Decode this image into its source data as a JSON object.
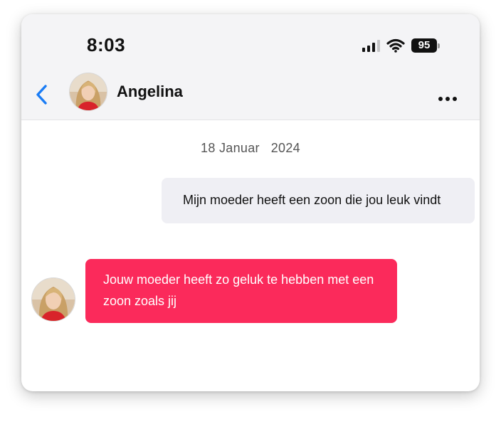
{
  "status_bar": {
    "time": "8:03",
    "battery": "95",
    "icons": [
      "signal-icon",
      "wifi-icon",
      "battery-icon"
    ]
  },
  "header": {
    "contact_name": "Angelina",
    "back_icon": "chevron-left-icon",
    "more_icon": "ellipsis-icon"
  },
  "chat": {
    "date": "18 Januar   2024",
    "messages": [
      {
        "direction": "outgoing",
        "text": "Mijn moeder heeft een zoon die jou leuk vindt"
      },
      {
        "direction": "incoming",
        "text": "Jouw moeder heeft zo geluk te hebben met een zoon zoals jij"
      }
    ]
  },
  "colors": {
    "accent_blue": "#1a7cf5",
    "incoming_bubble": "#fb2a5b",
    "outgoing_bubble": "#efeff4",
    "header_bg": "#f4f4f6"
  }
}
